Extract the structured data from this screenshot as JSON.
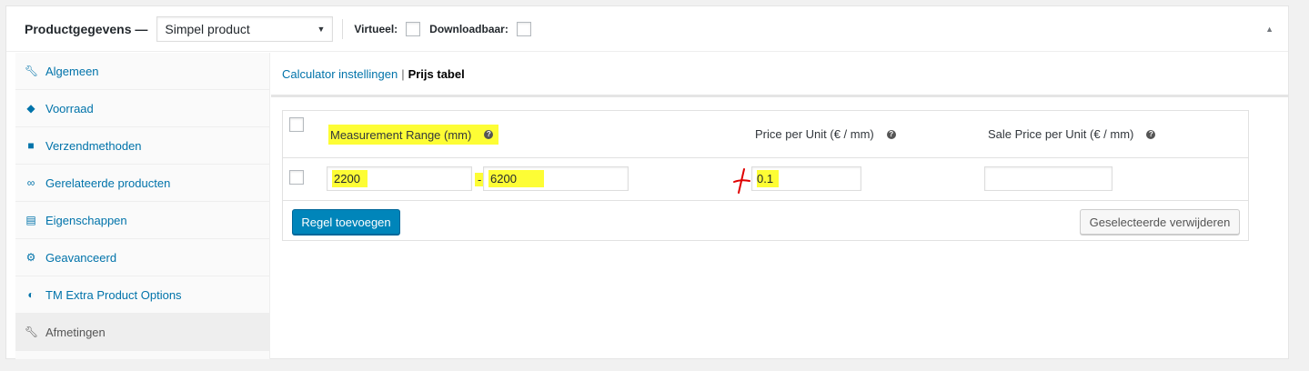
{
  "header": {
    "title": "Productgegevens —",
    "product_type": "Simpel product",
    "virtual_label": "Virtueel:",
    "downloadable_label": "Downloadbaar:"
  },
  "sidebar": {
    "items": [
      {
        "label": "Algemeen",
        "icon": "wrench-icon"
      },
      {
        "label": "Voorraad",
        "icon": "tag-icon"
      },
      {
        "label": "Verzendmethoden",
        "icon": "truck-icon"
      },
      {
        "label": "Gerelateerde producten",
        "icon": "link-icon"
      },
      {
        "label": "Eigenschappen",
        "icon": "list-icon"
      },
      {
        "label": "Geavanceerd",
        "icon": "gear-icon"
      },
      {
        "label": "TM Extra Product Options",
        "icon": "contrast-icon"
      },
      {
        "label": "Afmetingen",
        "icon": "wrench-icon",
        "active": true
      }
    ]
  },
  "subnav": {
    "calculator": "Calculator instellingen",
    "separator": "|",
    "price_table": "Prijs tabel"
  },
  "table": {
    "headers": {
      "range": "Measurement Range (mm)",
      "price": "Price per Unit (€ / mm)",
      "sale": "Sale Price per Unit (€ / mm)"
    },
    "help_glyph": "?",
    "rows": [
      {
        "range_from": "2200",
        "range_to": "6200",
        "price": "0.1",
        "sale": ""
      }
    ],
    "range_separator": "-"
  },
  "buttons": {
    "add_row": "Regel toevoegen",
    "delete_selected": "Geselecteerde verwijderen"
  },
  "colors": {
    "highlight": "#fdfd35",
    "link": "#0073aa",
    "primary": "#0085ba",
    "annotation": "#e00000"
  }
}
